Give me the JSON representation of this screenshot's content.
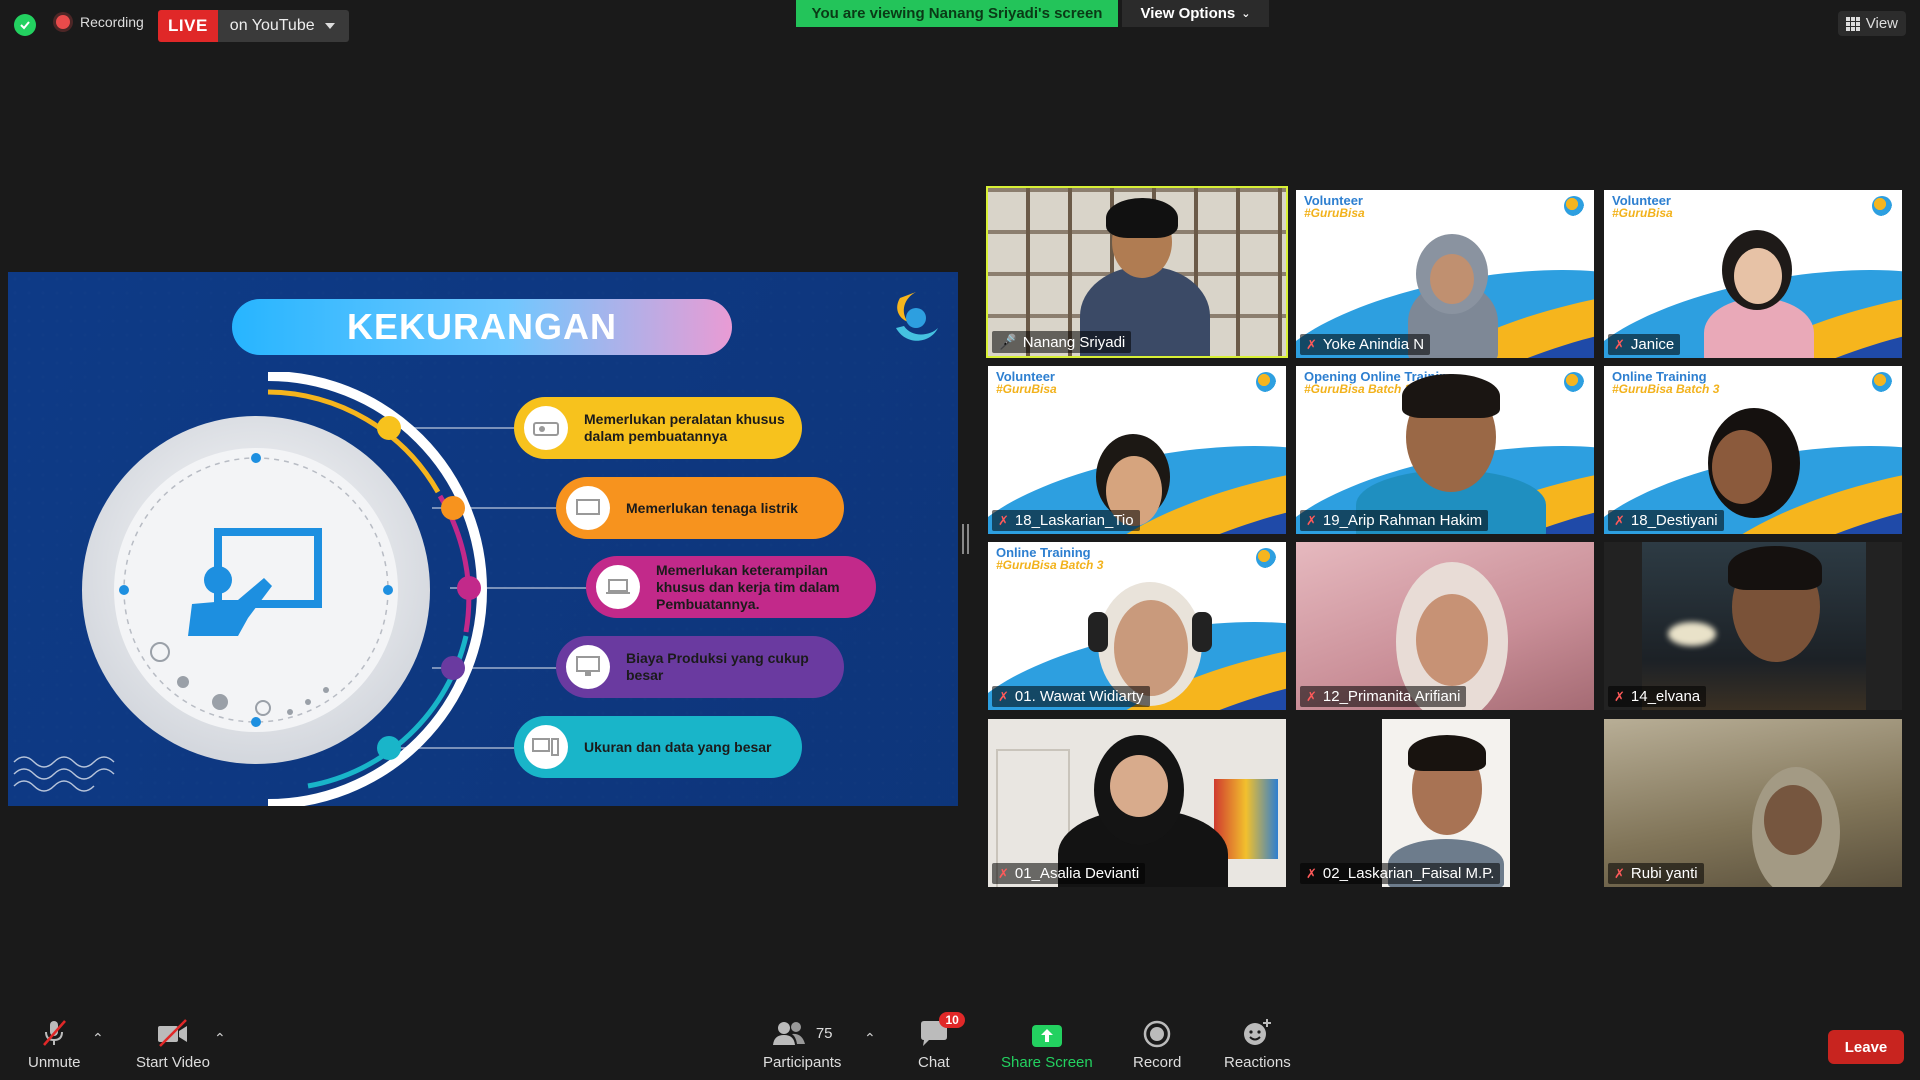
{
  "topbar": {
    "recording_label": "Recording",
    "live_label": "LIVE",
    "live_destination": "on YouTube",
    "viewing_banner": "You are viewing Nanang Sriyadi's screen",
    "view_options": "View Options",
    "view_button": "View"
  },
  "slide": {
    "title": "KEKURANGAN",
    "points": [
      {
        "text": "Memerlukan peralatan khusus dalam pembuatannya",
        "color": "#f7c21d",
        "icon": "projector-icon"
      },
      {
        "text": "Memerlukan tenaga listrik",
        "color": "#f7931e",
        "icon": "monitor-icon"
      },
      {
        "text": "Memerlukan keterampilan khusus dan kerja tim dalam Pembuatannya.",
        "color": "#c2298a",
        "icon": "laptop-icon"
      },
      {
        "text": "Biaya Produksi yang cukup besar",
        "color": "#6a3aa0",
        "icon": "desktop-icon"
      },
      {
        "text": "Ukuran dan data yang besar",
        "color": "#19b5c9",
        "icon": "computer-icon"
      }
    ]
  },
  "participants_grid": [
    {
      "name": "Nanang Sriyadi",
      "muted": false,
      "active": true
    },
    {
      "name": "Yoke Anindia N",
      "muted": true,
      "bg_title": "Volunteer",
      "bg_tag": "#GuruBisa"
    },
    {
      "name": "Janice",
      "muted": true,
      "bg_title": "Volunteer",
      "bg_tag": "#GuruBisa"
    },
    {
      "name": "18_Laskarian_Tio",
      "muted": true,
      "bg_title": "Volunteer",
      "bg_tag": "#GuruBisa"
    },
    {
      "name": "19_Arip Rahman Hakim",
      "muted": true,
      "bg_title": "Opening Online Training",
      "bg_tag": "#GuruBisa Batch 3"
    },
    {
      "name": "18_Destiyani",
      "muted": true,
      "bg_title": "Online Training",
      "bg_tag": "#GuruBisa Batch 3"
    },
    {
      "name": "01. Wawat Widiarty",
      "muted": true,
      "bg_title": "Online Training",
      "bg_tag": "#GuruBisa Batch 3"
    },
    {
      "name": "12_Primanita Arifiani",
      "muted": true
    },
    {
      "name": "14_elvana",
      "muted": true
    },
    {
      "name": "01_Asalia Devianti",
      "muted": true
    },
    {
      "name": "02_Laskarian_Faisal M.P.",
      "muted": true
    },
    {
      "name": "Rubi yanti",
      "muted": true
    }
  ],
  "toolbar": {
    "unmute": "Unmute",
    "start_video": "Start Video",
    "participants_label": "Participants",
    "participants_count": "75",
    "chat": "Chat",
    "chat_badge": "10",
    "share_screen": "Share Screen",
    "record": "Record",
    "reactions": "Reactions",
    "leave": "Leave"
  },
  "colors": {
    "accent_green": "#23d160",
    "live_red": "#e02828",
    "active_speaker": "#d8f035",
    "slide_bg": "#0f3d8a"
  }
}
